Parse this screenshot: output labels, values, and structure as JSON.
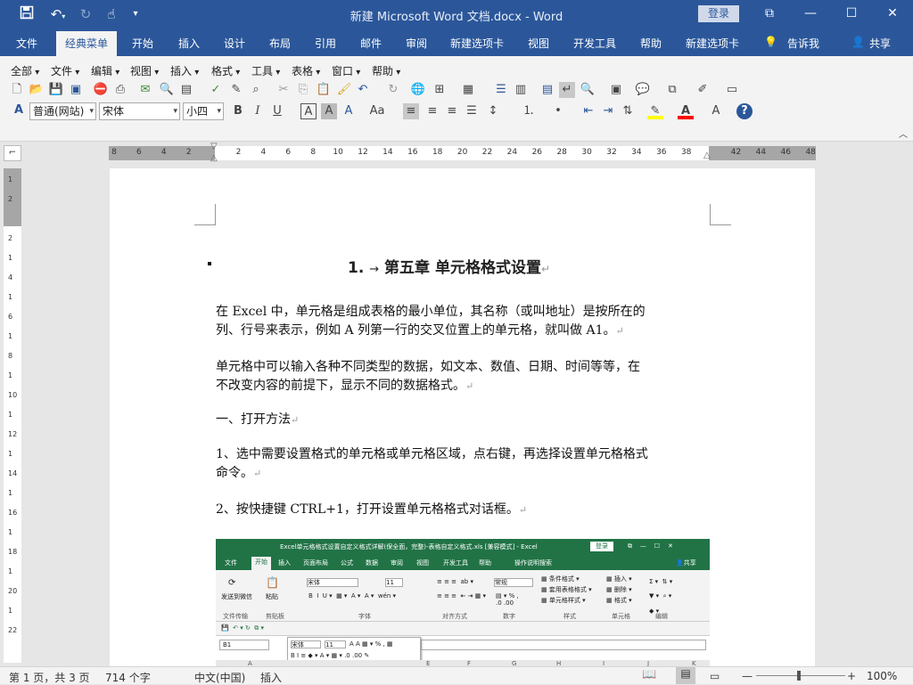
{
  "window": {
    "title": "新建 Microsoft Word 文档.docx  -  Word",
    "login_label": "登录",
    "controls": {
      "restore": "⧉",
      "minimize": "—",
      "maximize": "☐",
      "close": "✕"
    }
  },
  "menu_tabs": {
    "file": "文件",
    "classic": "经典菜单",
    "home": "开始",
    "insert": "插入",
    "design": "设计",
    "layout": "布局",
    "references": "引用",
    "mailings": "邮件",
    "review": "审阅",
    "newtab1": "新建选项卡",
    "view": "视图",
    "developer": "开发工具",
    "help": "帮助",
    "newtab2": "新建选项卡",
    "tellme": "告诉我",
    "share": "共享"
  },
  "classic_menu": {
    "all": "全部",
    "file": "文件",
    "edit": "编辑",
    "view": "视图",
    "insert": "插入",
    "format": "格式",
    "tools": "工具",
    "table": "表格",
    "window": "窗口",
    "help": "帮助"
  },
  "format_bar": {
    "style": "普通(网站)",
    "font": "宋体",
    "size": "小四"
  },
  "ruler_labels": [
    "8",
    "6",
    "4",
    "2",
    "",
    "2",
    "4",
    "6",
    "8",
    "10",
    "12",
    "14",
    "16",
    "18",
    "20",
    "22",
    "24",
    "26",
    "28",
    "30",
    "32",
    "34",
    "36",
    "38",
    "",
    "42",
    "44",
    "46",
    "48"
  ],
  "vruler_labels": [
    "1",
    "2",
    "",
    "2",
    "1",
    "4",
    "1",
    "6",
    "1",
    "8",
    "1",
    "10",
    "1",
    "12",
    "1",
    "14",
    "1",
    "16",
    "1",
    "18",
    "1",
    "20",
    "1",
    "22"
  ],
  "document": {
    "heading_num": "1.",
    "heading_text": "第五章 单元格格式设置",
    "para1_line1": "在 Excel 中，单元格是组成表格的最小单位，其名称（或叫地址）是按所在的",
    "para1_line2": "列、行号来表示，例如 A 列第一行的交叉位置上的单元格，就叫做 A1。",
    "para2_line1": "单元格中可以输入各种不同类型的数据，如文本、数值、日期、时间等等，在",
    "para2_line2": "不改变内容的前提下，显示不同的数据格式。",
    "para3": "一、打开方法",
    "para4_line1": "1、选中需要设置格式的单元格或单元格区域，点右键，再选择设置单元格格式",
    "para4_line2": "命令。",
    "para5": "2、按快捷键 CTRL+1，打开设置单元格格式对话框。"
  },
  "excel_image": {
    "title": "Excel单元格格式设置自定义格式详解(保全面，完整)-表格自定义格式.xls  [兼容模式]  -  Excel",
    "login": "登录",
    "tabs": [
      "文件",
      "开始",
      "插入",
      "页面布局",
      "公式",
      "数据",
      "审阅",
      "视图",
      "开发工具",
      "帮助",
      "操作说明搜索"
    ],
    "share": "共享",
    "font": "宋体",
    "size": "11",
    "number_format": "常规",
    "groups": [
      "文件传输",
      "剪贴板",
      "字体",
      "对齐方式",
      "数字",
      "样式",
      "单元格",
      "编辑"
    ],
    "send_label": "发送到微信",
    "paste_label": "粘贴",
    "style_items": [
      "条件格式",
      "套用表格格式",
      "单元格样式"
    ],
    "cell_items": [
      "插入",
      "删除",
      "格式"
    ],
    "name_box": "B1",
    "mini_font": "宋体",
    "mini_size": "11",
    "col_letters": [
      "A",
      "E",
      "F",
      "G",
      "H",
      "I",
      "J",
      "K"
    ]
  },
  "status": {
    "page": "第 1 页，共 3 页",
    "words": "714 个字",
    "lang": "中文(中国)",
    "mode": "插入",
    "zoom": "100%",
    "zoom_minus": "—",
    "zoom_plus": "+"
  },
  "colors": {
    "word_blue": "#2b579a",
    "excel_green": "#217346",
    "highlight": "#ffff00",
    "font_red": "#ff0000"
  }
}
